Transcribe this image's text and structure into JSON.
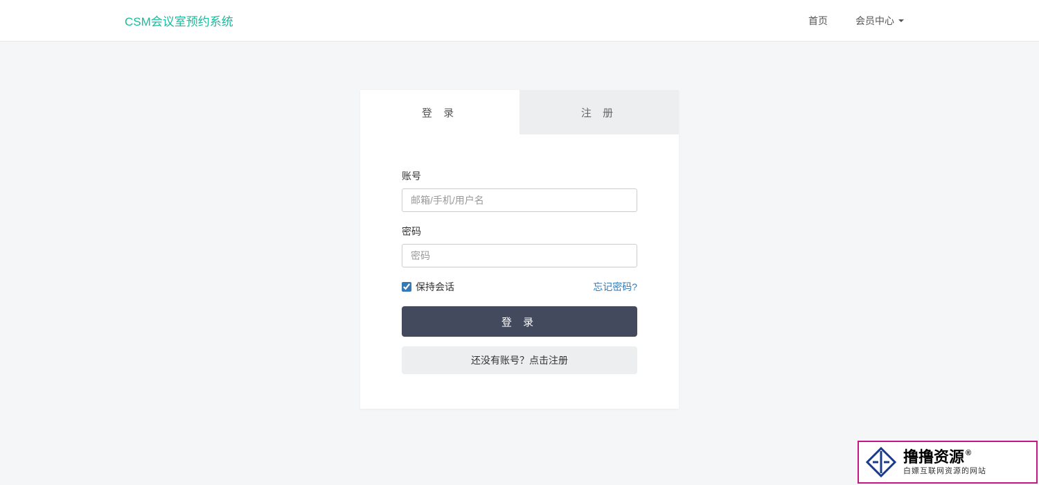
{
  "navbar": {
    "brand": "CSM会议室预约系统",
    "links": {
      "home": "首页",
      "member_center": "会员中心"
    }
  },
  "tabs": {
    "login": "登 录",
    "register": "注 册"
  },
  "form": {
    "account_label": "账号",
    "account_placeholder": "邮箱/手机/用户名",
    "password_label": "密码",
    "password_placeholder": "密码",
    "keep_session": "保持会话",
    "forgot": "忘记密码?",
    "submit": "登 录",
    "register_prompt": "还没有账号？点击注册"
  },
  "watermark": {
    "title": "撸撸资源",
    "reg": "®",
    "subtitle": "白嫖互联网资源的网站"
  }
}
